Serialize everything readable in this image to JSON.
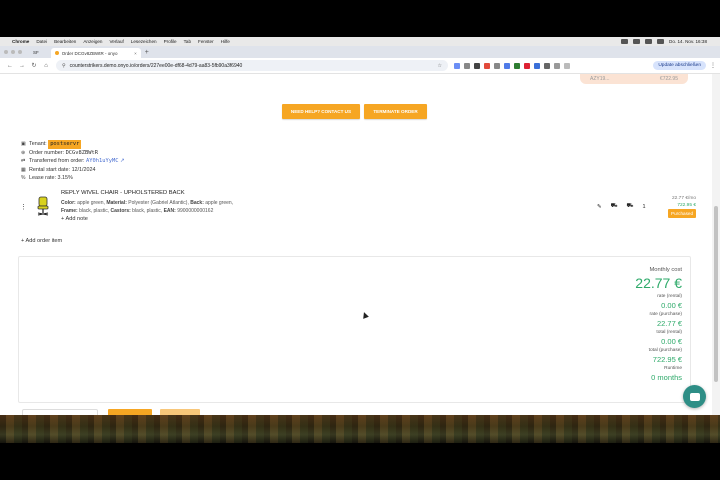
{
  "menubar": {
    "app": "Chrome",
    "items": [
      "Datei",
      "Bearbeiten",
      "Anzeigen",
      "Verlauf",
      "Lesezeichen",
      "Profile",
      "Tab",
      "Fenster",
      "Hilfe"
    ],
    "clock": "Do. 14. Nov. 16:38"
  },
  "browser": {
    "profile": "SF",
    "tab_title": "Order DCGv8ZBWtR - onyo",
    "url": "counterstrikers.demo.onyo.io/orders/227ee00e-df68-4d79-aa83-5fb90a3f6940",
    "update_label": "Update abschließen"
  },
  "top_chip": {
    "left": "AZY19...",
    "right": "€722.95"
  },
  "buttons": {
    "need_help": "NEED HELP? CONTACT US",
    "terminate": "TERMINATE ORDER"
  },
  "details": {
    "tenant_label": "Tenant:",
    "tenant_value": "postservr",
    "order_number_label": "Order number:",
    "order_number_value": "DCGv8ZBWtR",
    "transferred_label": "Transferred from order:",
    "transferred_value": "AY0h1uYyMC",
    "rental_start_label": "Rental start date:",
    "rental_start_value": "12/1/2024",
    "lease_rate_label": "Lease rate:",
    "lease_rate_value": "3.15%"
  },
  "order_item": {
    "title": "REPLY WIVEL CHAIR - UPHOLSTERED BACK",
    "spec_line_1_parts": [
      "Color:",
      " apple green, ",
      "Material:",
      " Polyester (Gabriel Atlantic), ",
      "Back:",
      " apple green,"
    ],
    "spec_line_2_parts": [
      "Frame:",
      " black, plastic, ",
      "Castors:",
      " black, plastic, ",
      "EAN:",
      " 9900000000162"
    ],
    "add_note": "+ Add note",
    "quantity": "1",
    "rate": "22.77 €/mo",
    "total": "722.95 €",
    "status": "Purchased"
  },
  "add_order_item": "+ Add order item",
  "costs": {
    "monthly_label": "Monthly cost",
    "monthly_value": "22.77 €",
    "rate_rental_label": "rate (rental)",
    "rate_rental_value": "0.00 €",
    "rate_purchase_label": "rate (purchase)",
    "rate_purchase_value": "22.77 €",
    "total_rental_label": "total (rental)",
    "total_rental_value": "0.00 €",
    "total_purchase_label": "total (purchase)",
    "total_purchase_value": "722.95 €",
    "runtime_label": "Runtime",
    "runtime_value": "0 months"
  },
  "colors": {
    "accent": "#f6a623",
    "money": "#2eaa6a",
    "chat": "#2e8e86"
  }
}
